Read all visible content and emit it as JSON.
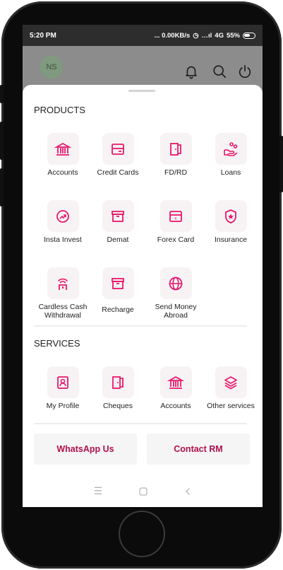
{
  "status_bar": {
    "time": "5:20 PM",
    "network": "... 0.00KB/s",
    "signal": "4G",
    "battery": "55%"
  },
  "header": {
    "avatar_initials": "NS"
  },
  "products": {
    "title": "PRODUCTS",
    "items": [
      {
        "label": "Accounts",
        "icon": "bank-icon"
      },
      {
        "label": "Credit Cards",
        "icon": "card-icon"
      },
      {
        "label": "FD/RD",
        "icon": "door-icon"
      },
      {
        "label": "Loans",
        "icon": "loan-hand-icon"
      },
      {
        "label": "Insta Invest",
        "icon": "growth-icon"
      },
      {
        "label": "Demat",
        "icon": "archive-icon"
      },
      {
        "label": "Forex Card",
        "icon": "forex-card-icon"
      },
      {
        "label": "Insurance",
        "icon": "shield-star-icon"
      },
      {
        "label": "Cardless Cash Withdrawal",
        "label_line1": "Cardless Cash",
        "label_line2": "Withdrawal",
        "icon": "atm-wifi-icon"
      },
      {
        "label": "Recharge",
        "icon": "recharge-icon"
      },
      {
        "label": "Send Money Abroad",
        "label_line1": "Send Money",
        "label_line2": "Abroad",
        "icon": "globe-icon"
      }
    ]
  },
  "services": {
    "title": "SERVICES",
    "items": [
      {
        "label": "My Profile",
        "icon": "profile-icon"
      },
      {
        "label": "Cheques",
        "icon": "cheque-icon"
      },
      {
        "label": "Accounts",
        "icon": "bank-icon"
      },
      {
        "label": "Other services",
        "icon": "layers-icon"
      }
    ]
  },
  "actions": {
    "whatsapp_label": "WhatsApp Us",
    "contact_label": "Contact RM"
  },
  "colors": {
    "accent": "#e8186b",
    "action_text": "#b0104c"
  }
}
